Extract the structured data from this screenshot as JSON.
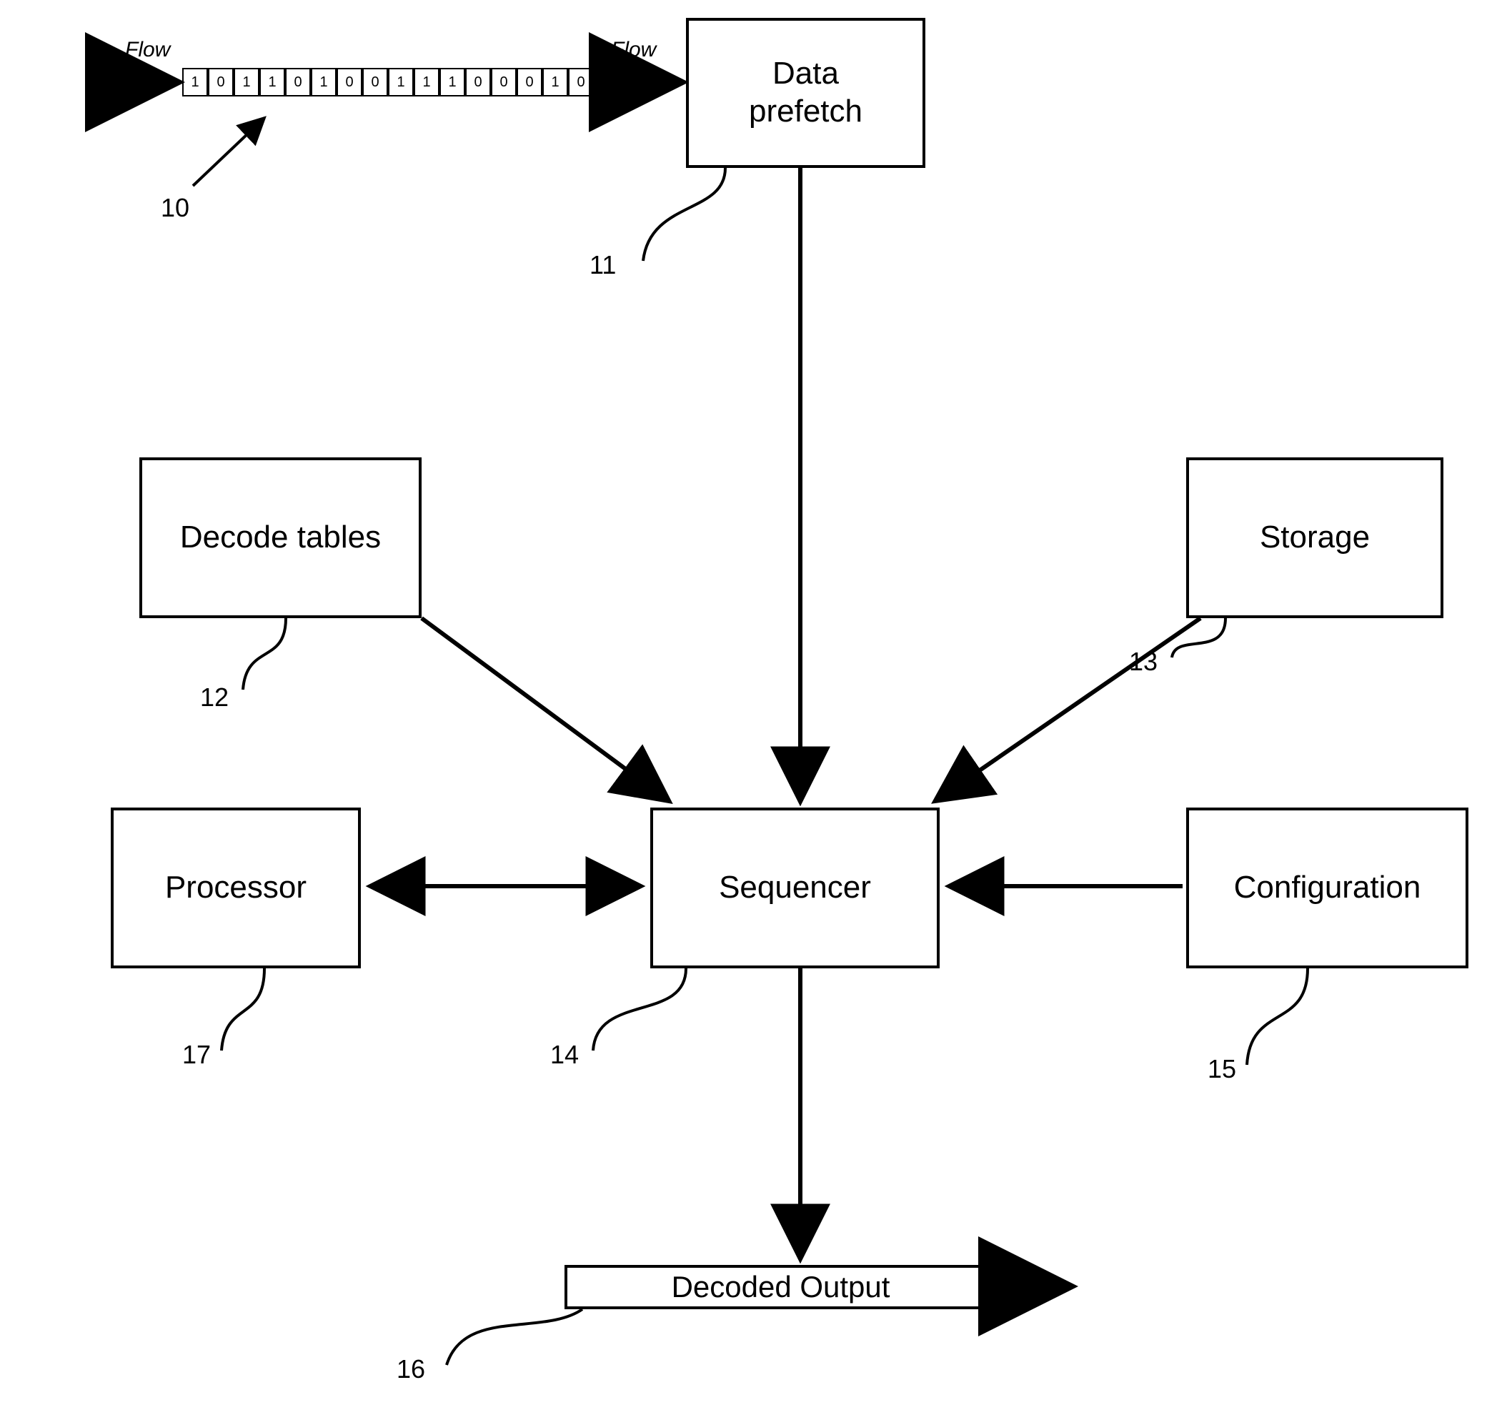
{
  "flow_label_left": "Flow",
  "flow_label_right": "Flow",
  "bitstream": [
    "1",
    "0",
    "1",
    "1",
    "0",
    "1",
    "0",
    "0",
    "1",
    "1",
    "1",
    "0",
    "0",
    "0",
    "1",
    "0"
  ],
  "boxes": {
    "data_prefetch": "Data\nprefetch",
    "decode_tables": "Decode tables",
    "storage": "Storage",
    "processor": "Processor",
    "sequencer": "Sequencer",
    "configuration": "Configuration",
    "decoded_output": "Decoded Output"
  },
  "ref_numbers": {
    "bitstream": "10",
    "data_prefetch": "11",
    "decode_tables": "12",
    "storage": "13",
    "sequencer": "14",
    "configuration": "15",
    "decoded_output": "16",
    "processor": "17"
  }
}
